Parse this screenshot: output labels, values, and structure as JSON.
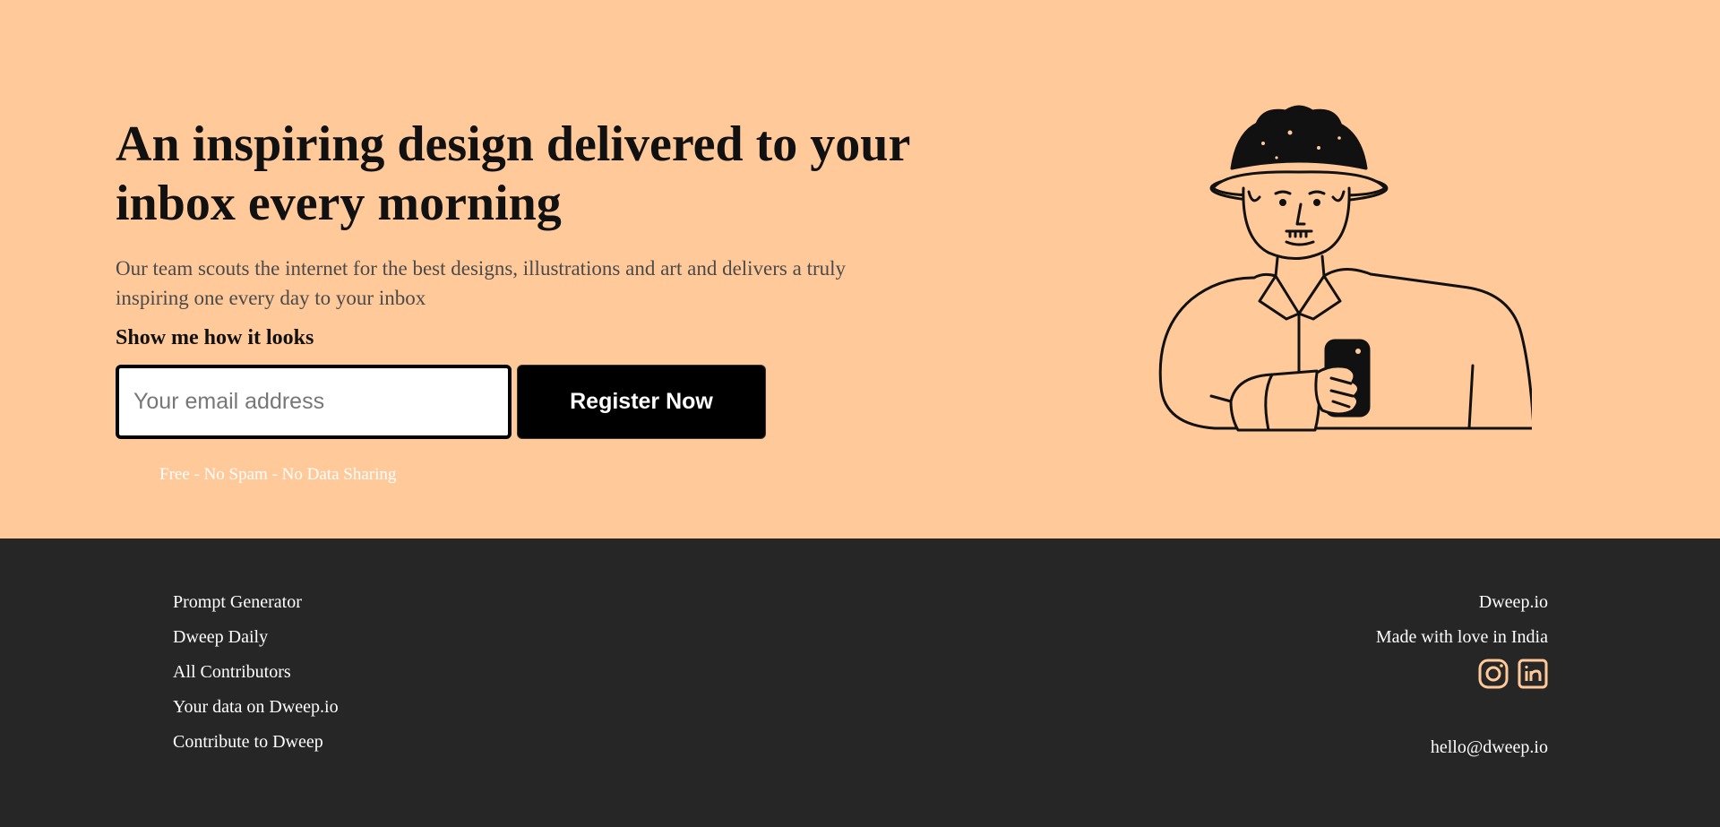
{
  "hero": {
    "title": "An inspiring design delivered to your inbox every morning",
    "description": "Our team scouts the internet for the best designs, illustrations and art and delivers a truly inspiring one every day to your inbox",
    "cta_label": "Show me how it looks",
    "email_placeholder": "Your email address",
    "register_label": "Register Now",
    "fine_print": "Free - No Spam - No Data Sharing",
    "illustration": "man-with-hat-holding-phone-illustration"
  },
  "footer": {
    "links": [
      "Prompt Generator",
      "Dweep Daily",
      "All Contributors",
      "Your data on Dweep.io",
      "Contribute to Dweep"
    ],
    "brand": "Dweep.io",
    "tagline": "Made with love in India",
    "social": [
      "instagram-icon",
      "linkedin-icon"
    ],
    "email": "hello@dweep.io"
  },
  "colors": {
    "hero_bg": "#ffc999",
    "footer_bg": "#262626",
    "button_bg": "#000000",
    "icon_accent": "#ffc999"
  }
}
